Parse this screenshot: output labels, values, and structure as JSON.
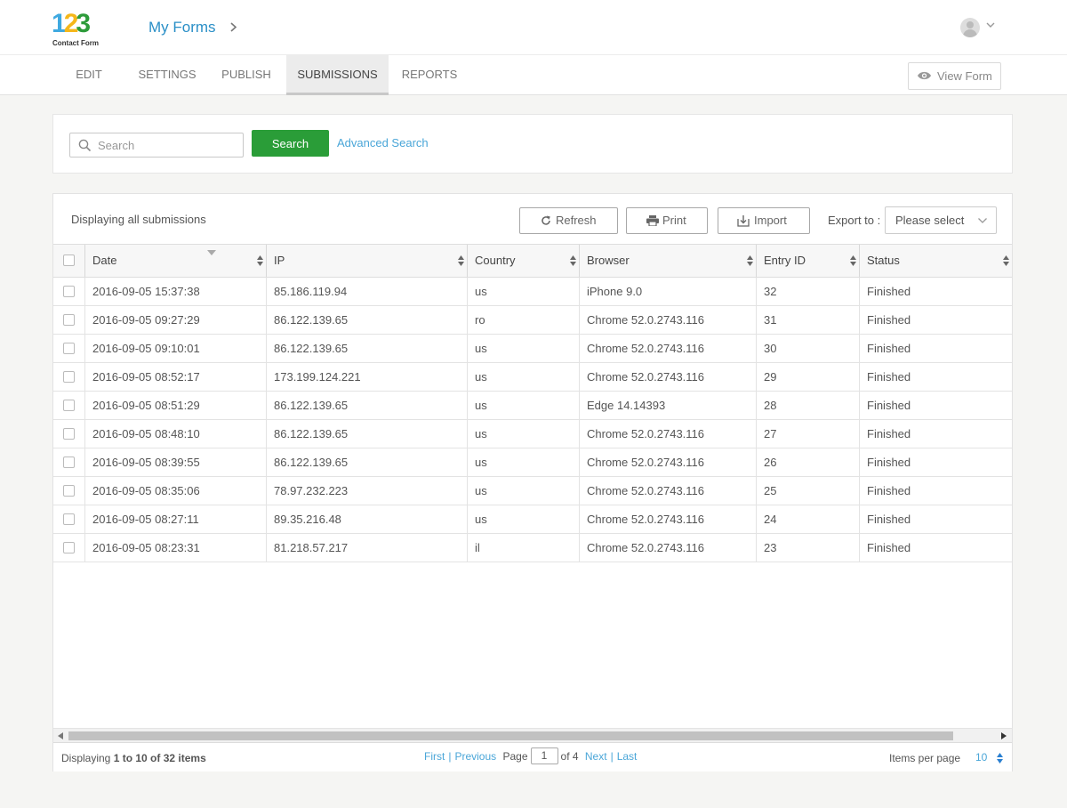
{
  "header": {
    "logo_digits": [
      "1",
      "2",
      "3"
    ],
    "logo_subtitle": "Contact Form",
    "breadcrumb": "My Forms",
    "colors": {
      "logo_1": "#3fa9e0",
      "logo_2": "#f5b71a",
      "logo_3": "#2d9b3a",
      "link": "#2a8fc7"
    }
  },
  "tabs": [
    {
      "label": "EDIT",
      "active": false
    },
    {
      "label": "SETTINGS",
      "active": false
    },
    {
      "label": "PUBLISH",
      "active": false
    },
    {
      "label": "SUBMISSIONS",
      "active": true
    },
    {
      "label": "REPORTS",
      "active": false
    }
  ],
  "view_form_label": "View Form",
  "search": {
    "placeholder": "Search",
    "value": "",
    "button_label": "Search",
    "advanced_label": "Advanced Search",
    "button_color": "#2a9d38"
  },
  "toolbar": {
    "status_text": "Displaying all submissions",
    "refresh_label": "Refresh",
    "print_label": "Print",
    "import_label": "Import",
    "export_label": "Export to :",
    "export_selected": "Please select"
  },
  "table": {
    "columns": [
      "Date",
      "IP",
      "Country",
      "Browser",
      "Entry ID",
      "Status"
    ],
    "sorted_column": "Date",
    "rows": [
      [
        "2016-09-05 15:37:38",
        "85.186.119.94",
        "us",
        "iPhone 9.0",
        "32",
        "Finished"
      ],
      [
        "2016-09-05 09:27:29",
        "86.122.139.65",
        "ro",
        "Chrome 52.0.2743.116",
        "31",
        "Finished"
      ],
      [
        "2016-09-05 09:10:01",
        "86.122.139.65",
        "us",
        "Chrome 52.0.2743.116",
        "30",
        "Finished"
      ],
      [
        "2016-09-05 08:52:17",
        "173.199.124.221",
        "us",
        "Chrome 52.0.2743.116",
        "29",
        "Finished"
      ],
      [
        "2016-09-05 08:51:29",
        "86.122.139.65",
        "us",
        "Edge 14.14393",
        "28",
        "Finished"
      ],
      [
        "2016-09-05 08:48:10",
        "86.122.139.65",
        "us",
        "Chrome 52.0.2743.116",
        "27",
        "Finished"
      ],
      [
        "2016-09-05 08:39:55",
        "86.122.139.65",
        "us",
        "Chrome 52.0.2743.116",
        "26",
        "Finished"
      ],
      [
        "2016-09-05 08:35:06",
        "78.97.232.223",
        "us",
        "Chrome 52.0.2743.116",
        "25",
        "Finished"
      ],
      [
        "2016-09-05 08:27:11",
        "89.35.216.48",
        "us",
        "Chrome 52.0.2743.116",
        "24",
        "Finished"
      ],
      [
        "2016-09-05 08:23:31",
        "81.218.57.217",
        "il",
        "Chrome 52.0.2743.116",
        "23",
        "Finished"
      ]
    ]
  },
  "footer": {
    "info_prefix": "Displaying",
    "info_range": "1 to 10 of 32 items",
    "first_label": "First",
    "previous_label": "Previous",
    "page_label": "Page",
    "page_value": "1",
    "of_label": "of 4",
    "next_label": "Next",
    "last_label": "Last",
    "items_per_page_label": "Items per page",
    "items_per_page_value": "10"
  }
}
